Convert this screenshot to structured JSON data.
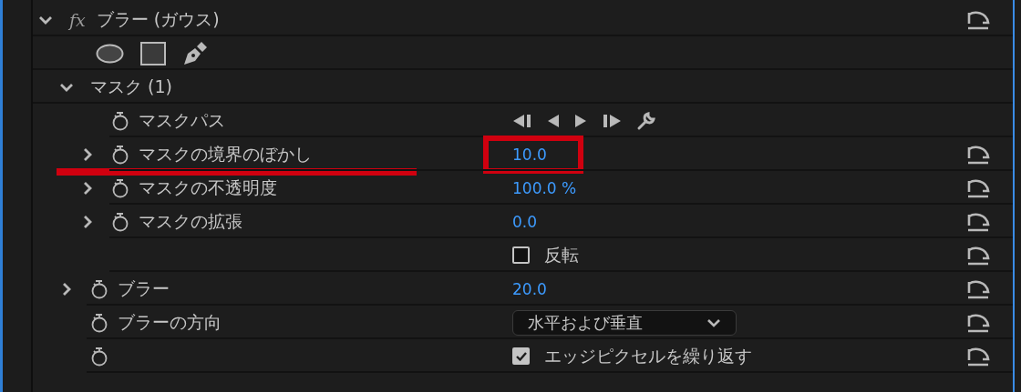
{
  "effect": {
    "fx": "fx",
    "title": "ブラー (ガウス)",
    "expanded": true,
    "reset": true,
    "children": [
      {
        "kind": "group",
        "label": "マスク (1)",
        "expanded": true,
        "children": [
          {
            "kind": "keyframes",
            "label": "マスクパス",
            "stopwatch": true,
            "reset": false
          },
          {
            "kind": "value",
            "label": "マスクの境界のぼかし",
            "value": "10.0",
            "expanded": false,
            "stopwatch": true,
            "reset": true,
            "highlighted": true
          },
          {
            "kind": "value",
            "label": "マスクの不透明度",
            "value": "100.0 %",
            "expanded": false,
            "stopwatch": true,
            "reset": true,
            "highlighted": false
          },
          {
            "kind": "value",
            "label": "マスクの拡張",
            "value": "0.0",
            "expanded": false,
            "stopwatch": true,
            "reset": true,
            "highlighted": false
          },
          {
            "kind": "checkbox",
            "text": "反転",
            "checked": false,
            "stopwatch": false,
            "reset": true
          }
        ]
      },
      {
        "kind": "value",
        "label": "ブラー",
        "value": "20.0",
        "expanded": false,
        "stopwatch": true,
        "reset": true,
        "highlighted": false
      },
      {
        "kind": "dropdown",
        "label": "ブラーの方向",
        "value": "水平および垂直",
        "stopwatch": true,
        "reset": true
      },
      {
        "kind": "checkbox",
        "text": "エッジピクセルを繰り返す",
        "checked": true,
        "stopwatch": true,
        "reset": true
      }
    ]
  }
}
